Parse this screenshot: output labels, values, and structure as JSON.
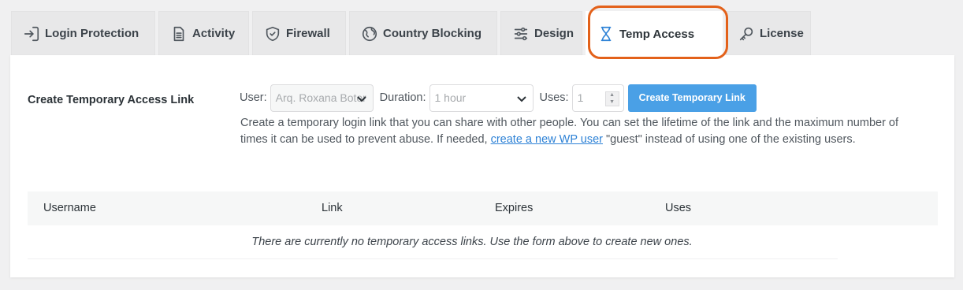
{
  "tabs": [
    {
      "label": "Login Protection",
      "icon": "login-icon"
    },
    {
      "label": "Activity",
      "icon": "document-icon"
    },
    {
      "label": "Firewall",
      "icon": "shield-icon"
    },
    {
      "label": "Country Blocking",
      "icon": "globe-icon"
    },
    {
      "label": "Design",
      "icon": "sliders-icon"
    },
    {
      "label": "Temp Access",
      "icon": "hourglass-icon",
      "active": true
    },
    {
      "label": "License",
      "icon": "key-icon"
    }
  ],
  "form": {
    "title": "Create Temporary Access Link",
    "user_label": "User:",
    "user_value": "Arq. Roxana Boter",
    "duration_label": "Duration:",
    "duration_value": "1 hour",
    "uses_label": "Uses:",
    "uses_value": "1",
    "create_button": "Create Temporary Link",
    "desc_before": "Create a temporary login link that you can share with other people. You can set the lifetime of the link and the maximum number of times it can be used to prevent abuse. If needed, ",
    "desc_link": "create a new WP user",
    "desc_after": " \"guest\" instead of using one of the existing users."
  },
  "table": {
    "columns": [
      "Username",
      "Link",
      "Expires",
      "Uses"
    ],
    "empty_message": "There are currently no temporary access links. Use the form above to create new ones."
  },
  "colors": {
    "accent": "#2e82d6",
    "button": "#4aa0e6",
    "highlight": "#e3611a"
  }
}
